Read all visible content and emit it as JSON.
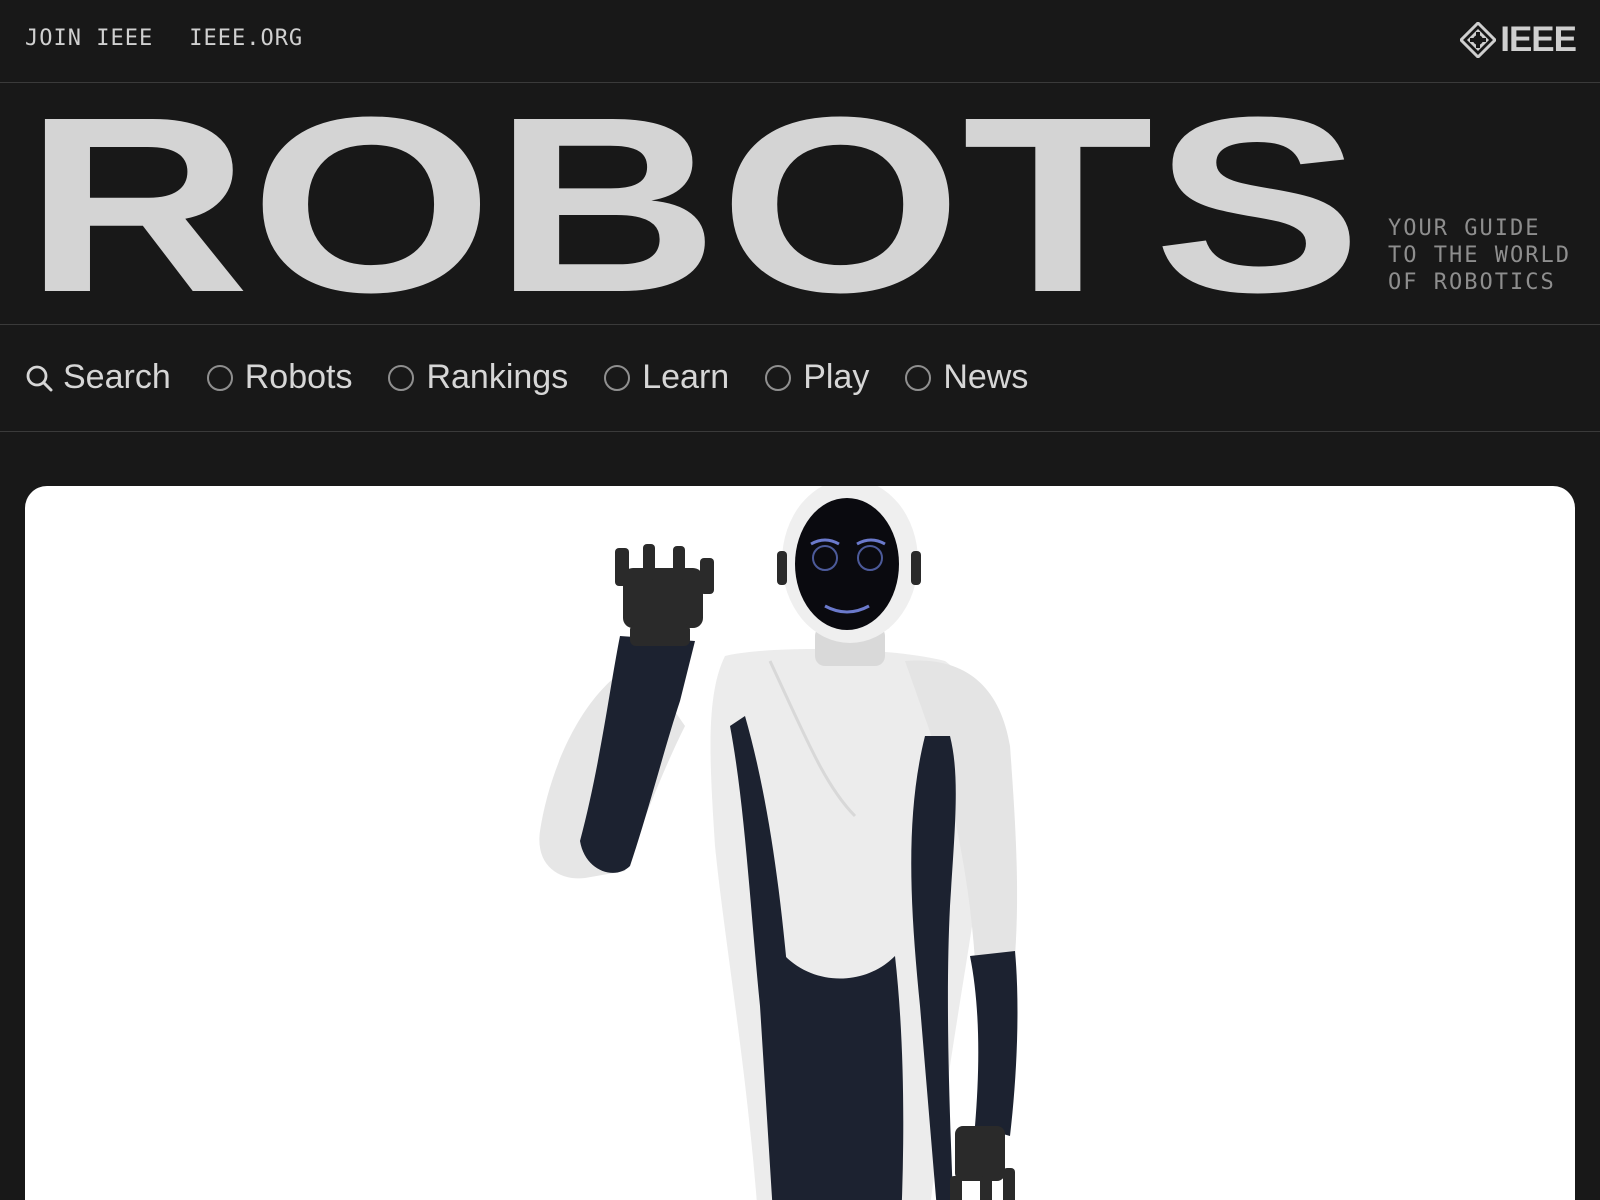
{
  "topbar": {
    "links": [
      "JOIN IEEE",
      "IEEE.ORG"
    ],
    "logo_text": "IEEE"
  },
  "masthead": {
    "wordmark": "ROBOTS",
    "tagline": [
      "YOUR GUIDE",
      "TO THE WORLD",
      "OF ROBOTICS"
    ]
  },
  "nav": {
    "search_label": "Search",
    "items": [
      "Robots",
      "Rankings",
      "Learn",
      "Play",
      "News"
    ]
  },
  "colors": {
    "background": "#181818",
    "text": "#d6d6d6",
    "muted": "#8e8e8e",
    "card": "#ffffff"
  },
  "icons": [
    "ieee-diamond-icon",
    "search-icon",
    "radio-circle-icon"
  ]
}
